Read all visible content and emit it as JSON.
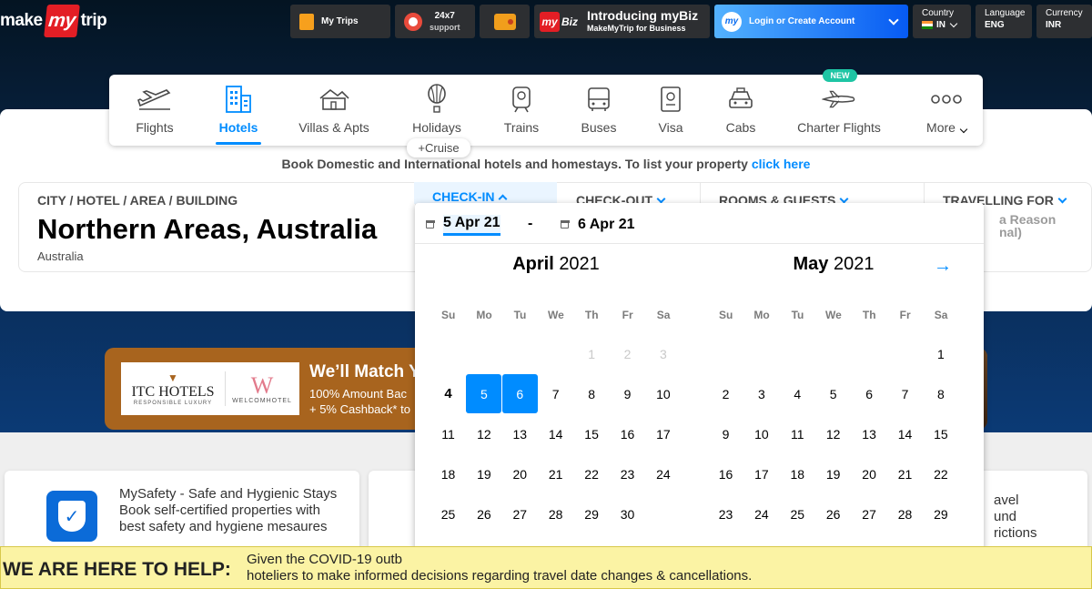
{
  "header": {
    "logo_make": "make",
    "logo_my": "my",
    "logo_trip": "trip",
    "my_trips": "My Trips",
    "support_line1": "24x7",
    "support_line2": "support",
    "mybiz_badge": "Biz",
    "mybiz_title": "Introducing myBiz",
    "mybiz_sub": "MakeMyTrip for Business",
    "login_label": "Login or Create Account",
    "country_label": "Country",
    "country_value": "IN",
    "language_label": "Language",
    "language_value": "ENG",
    "currency_label": "Currency",
    "currency_value": "INR"
  },
  "nav": {
    "items": [
      {
        "label": "Flights",
        "icon": "flight-icon"
      },
      {
        "label": "Hotels",
        "icon": "hotel-icon"
      },
      {
        "label": "Villas & Apts",
        "icon": "villa-icon"
      },
      {
        "label": "Holidays",
        "icon": "balloon-icon"
      },
      {
        "label": "Trains",
        "icon": "train-icon"
      },
      {
        "label": "Buses",
        "icon": "bus-icon"
      },
      {
        "label": "Visa",
        "icon": "passport-icon"
      },
      {
        "label": "Cabs",
        "icon": "cab-icon"
      },
      {
        "label": "Charter Flights",
        "icon": "charter-plane-icon"
      },
      {
        "label": "More",
        "icon": "more-dots-icon"
      }
    ],
    "active": "Hotels",
    "cruise_label": "+Cruise",
    "new_tag": "NEW"
  },
  "tagline": {
    "text": "Book Domestic and International hotels and homestays. To list your property ",
    "link": "click here"
  },
  "search": {
    "city_label": "CITY / HOTEL / AREA / BUILDING",
    "city_value": "Northern Areas, Australia",
    "city_country": "Australia",
    "checkin_label": "CHECK-IN",
    "checkout_label": "CHECK-OUT",
    "rooms_label": "ROOMS & GUESTS",
    "travelling_label": "TRAVELLING FOR",
    "travelling_value_line1": "a Reason",
    "travelling_value_line2": "nal)"
  },
  "datepicker": {
    "checkin_date": "5 Apr 21",
    "checkout_date": "6 Apr 21",
    "dash": "-",
    "weekdays": [
      "Su",
      "Mo",
      "Tu",
      "We",
      "Th",
      "Fr",
      "Sa"
    ],
    "months": [
      {
        "name": "April",
        "year": "2021",
        "first_weekday": 4,
        "days": 30,
        "disabled_days": [
          1,
          2,
          3
        ],
        "today": 4,
        "selected_days": [
          5,
          6
        ]
      },
      {
        "name": "May",
        "year": "2021",
        "first_weekday": 6,
        "days": 31,
        "disabled_days": [],
        "today": null,
        "selected_days": []
      }
    ],
    "next_arrow": "→"
  },
  "promo": {
    "itc_name": "ITC HOTELS",
    "itc_tag": "RESPONSIBLE LUXURY",
    "welcom_w": "W",
    "welcom_name": "WELCOMHOTEL",
    "title": "We’ll Match Y",
    "sub_line1": "100% Amount Bac",
    "sub_line2": "+ 5% Cashback* to"
  },
  "info": {
    "safety_text": "MySafety - Safe and Hygienic Stays Book self-certified properties with best safety and hygiene mesaures",
    "right_line1": "avel",
    "right_line2": "und",
    "right_line3": "rictions"
  },
  "banner": {
    "title": "WE ARE HERE TO HELP:",
    "line1": "Given the COVID-19 outb",
    "line2": "hoteliers to make informed decisions regarding travel date changes & cancellations."
  },
  "colors": {
    "brand_blue": "#008cff",
    "brand_red": "#e31e25",
    "hero_dark": "#041422",
    "banner_yellow": "#fbf3a4"
  }
}
